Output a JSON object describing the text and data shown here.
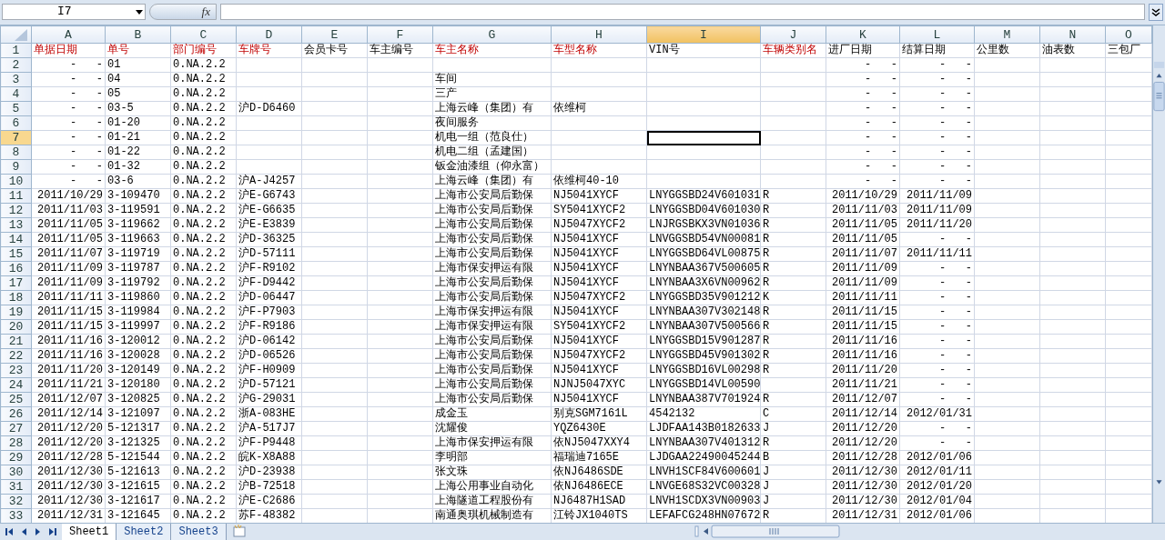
{
  "name_box": "I7",
  "function_label": "fx",
  "columns": [
    {
      "letter": "A",
      "selected": false
    },
    {
      "letter": "B",
      "selected": false
    },
    {
      "letter": "C",
      "selected": false
    },
    {
      "letter": "D",
      "selected": false
    },
    {
      "letter": "E",
      "selected": false
    },
    {
      "letter": "F",
      "selected": false
    },
    {
      "letter": "G",
      "selected": false
    },
    {
      "letter": "H",
      "selected": false
    },
    {
      "letter": "I",
      "selected": true
    },
    {
      "letter": "J",
      "selected": false
    },
    {
      "letter": "K",
      "selected": false
    },
    {
      "letter": "L",
      "selected": false
    },
    {
      "letter": "M",
      "selected": false
    },
    {
      "letter": "N",
      "selected": false
    },
    {
      "letter": "O",
      "selected": false
    }
  ],
  "field_row": {
    "number": "1",
    "selected": false,
    "cells": [
      {
        "text": "单据日期",
        "highlighted": true
      },
      {
        "text": "单号",
        "highlighted": true
      },
      {
        "text": "部门编号",
        "highlighted": true
      },
      {
        "text": "车牌号",
        "highlighted": true
      },
      {
        "text": "会员卡号",
        "highlighted": false
      },
      {
        "text": "车主编号",
        "highlighted": false
      },
      {
        "text": "车主名称",
        "highlighted": true
      },
      {
        "text": "车型名称",
        "highlighted": true
      },
      {
        "text": "VIN号",
        "highlighted": false
      },
      {
        "text": "车辆类别名",
        "highlighted": true
      },
      {
        "text": "进厂日期",
        "highlighted": false
      },
      {
        "text": "结算日期",
        "highlighted": false
      },
      {
        "text": "公里数",
        "highlighted": false
      },
      {
        "text": "油表数",
        "highlighted": false
      },
      {
        "text": "三包厂",
        "highlighted": false
      }
    ]
  },
  "rows": [
    {
      "number": "2",
      "selected": false,
      "cells": {
        "A": "-   -",
        "B": "01",
        "C": "0.NA.2.2",
        "K": "-   -",
        "L": "-   -"
      }
    },
    {
      "number": "3",
      "selected": false,
      "cells": {
        "A": "-   -",
        "B": "04",
        "C": "0.NA.2.2",
        "G": "车间",
        "K": "-   -",
        "L": "-   -"
      }
    },
    {
      "number": "4",
      "selected": false,
      "cells": {
        "A": "-   -",
        "B": "05",
        "C": "0.NA.2.2",
        "G": "三产",
        "K": "-   -",
        "L": "-   -"
      }
    },
    {
      "number": "5",
      "selected": false,
      "cells": {
        "A": "-   -",
        "B": "03-5",
        "C": "0.NA.2.2",
        "D": "沪D-D6460",
        "G": "上海云峰（集团）有",
        "H": "依维柯",
        "K": "-   -",
        "L": "-   -"
      }
    },
    {
      "number": "6",
      "selected": false,
      "cells": {
        "A": "-   -",
        "B": "01-20",
        "C": "0.NA.2.2",
        "G": "夜间服务",
        "K": "-   -",
        "L": "-   -"
      }
    },
    {
      "number": "7",
      "selected": true,
      "cells": {
        "A": "-   -",
        "B": "01-21",
        "C": "0.NA.2.2",
        "G": "机电一组（范良仕）",
        "K": "-   -",
        "L": "-   -"
      }
    },
    {
      "number": "8",
      "selected": false,
      "cells": {
        "A": "-   -",
        "B": "01-22",
        "C": "0.NA.2.2",
        "G": "机电二组（孟建国）",
        "K": "-   -",
        "L": "-   -"
      }
    },
    {
      "number": "9",
      "selected": false,
      "cells": {
        "A": "-   -",
        "B": "01-32",
        "C": "0.NA.2.2",
        "G": "钣金油漆组（仰永富）",
        "K": "-   -",
        "L": "-   -"
      }
    },
    {
      "number": "10",
      "selected": false,
      "cells": {
        "A": "-   -",
        "B": "03-6",
        "C": "0.NA.2.2",
        "D": "沪A-J4257",
        "G": "上海云峰（集团）有",
        "H": "依维柯40-10",
        "K": "-   -",
        "L": "-   -"
      }
    },
    {
      "number": "11",
      "selected": false,
      "cells": {
        "A": "2011/10/29",
        "B": "3-109470",
        "C": "0.NA.2.2",
        "D": "沪E-G6743",
        "G": "上海市公安局后勤保",
        "H": "NJ5041XYCF",
        "I": "LNYGGSBD24V601031",
        "J": "R",
        "K": "2011/10/29",
        "L": "2011/11/09"
      }
    },
    {
      "number": "12",
      "selected": false,
      "cells": {
        "A": "2011/11/03",
        "B": "3-119591",
        "C": "0.NA.2.2",
        "D": "沪E-G6635",
        "G": "上海市公安局后勤保",
        "H": "SY5041XYCF2",
        "I": "LNYGGSBD04V601030",
        "J": "R",
        "K": "2011/11/03",
        "L": "2011/11/09"
      }
    },
    {
      "number": "13",
      "selected": false,
      "cells": {
        "A": "2011/11/05",
        "B": "3-119662",
        "C": "0.NA.2.2",
        "D": "沪E-E3839",
        "G": "上海市公安局后勤保",
        "H": "NJ5047XYCF2",
        "I": "LNJRGSBKX3VN01036",
        "J": "R",
        "K": "2011/11/05",
        "L": "2011/11/20"
      }
    },
    {
      "number": "14",
      "selected": false,
      "cells": {
        "A": "2011/11/05",
        "B": "3-119663",
        "C": "0.NA.2.2",
        "D": "沪D-36325",
        "G": "上海市公安局后勤保",
        "H": "NJ5041XYCF",
        "I": "LNVGGSBD54VN00081",
        "J": "R",
        "K": "2011/11/05",
        "L": "-   -"
      }
    },
    {
      "number": "15",
      "selected": false,
      "cells": {
        "A": "2011/11/07",
        "B": "3-119719",
        "C": "0.NA.2.2",
        "D": "沪D-57111",
        "G": "上海市公安局后勤保",
        "H": "NJ5041XYCF",
        "I": "LNYGGSBD64VL00875",
        "J": "R",
        "K": "2011/11/07",
        "L": "2011/11/11"
      }
    },
    {
      "number": "16",
      "selected": false,
      "cells": {
        "A": "2011/11/09",
        "B": "3-119787",
        "C": "0.NA.2.2",
        "D": "沪F-R9102",
        "G": "上海市保安押运有限",
        "H": "NJ5041XYCF",
        "I": "LNYNBAA367V500605",
        "J": "R",
        "K": "2011/11/09",
        "L": "-   -"
      }
    },
    {
      "number": "17",
      "selected": false,
      "cells": {
        "A": "2011/11/09",
        "B": "3-119792",
        "C": "0.NA.2.2",
        "D": "沪F-D9442",
        "G": "上海市公安局后勤保",
        "H": "NJ5041XYCF",
        "I": "LNYNBAA3X6VN00962",
        "J": "R",
        "K": "2011/11/09",
        "L": "-   -"
      }
    },
    {
      "number": "18",
      "selected": false,
      "cells": {
        "A": "2011/11/11",
        "B": "3-119860",
        "C": "0.NA.2.2",
        "D": "沪D-06447",
        "G": "上海市公安局后勤保",
        "H": "NJ5047XYCF2",
        "I": "LNYGGSBD35V901212",
        "J": "K",
        "K": "2011/11/11",
        "L": "-   -"
      }
    },
    {
      "number": "19",
      "selected": false,
      "cells": {
        "A": "2011/11/15",
        "B": "3-119984",
        "C": "0.NA.2.2",
        "D": "沪F-P7903",
        "G": "上海市保安押运有限",
        "H": "NJ5041XYCF",
        "I": "LNYNBAA307V302148",
        "J": "R",
        "K": "2011/11/15",
        "L": "-   -"
      }
    },
    {
      "number": "20",
      "selected": false,
      "cells": {
        "A": "2011/11/15",
        "B": "3-119997",
        "C": "0.NA.2.2",
        "D": "沪F-R9186",
        "G": "上海市保安押运有限",
        "H": "SY5041XYCF2",
        "I": "LNYNBAA307V500566",
        "J": "R",
        "K": "2011/11/15",
        "L": "-   -"
      }
    },
    {
      "number": "21",
      "selected": false,
      "cells": {
        "A": "2011/11/16",
        "B": "3-120012",
        "C": "0.NA.2.2",
        "D": "沪D-06142",
        "G": "上海市公安局后勤保",
        "H": "NJ5041XYCF",
        "I": "LNYGGSBD15V901287",
        "J": "R",
        "K": "2011/11/16",
        "L": "-   -"
      }
    },
    {
      "number": "22",
      "selected": false,
      "cells": {
        "A": "2011/11/16",
        "B": "3-120028",
        "C": "0.NA.2.2",
        "D": "沪D-06526",
        "G": "上海市公安局后勤保",
        "H": "NJ5047XYCF2",
        "I": "LNYGGSBD45V901302",
        "J": "R",
        "K": "2011/11/16",
        "L": "-   -"
      }
    },
    {
      "number": "23",
      "selected": false,
      "cells": {
        "A": "2011/11/20",
        "B": "3-120149",
        "C": "0.NA.2.2",
        "D": "沪F-H0909",
        "G": "上海市公安局后勤保",
        "H": "NJ5041XYCF",
        "I": "LNYGGSBD16VL00298",
        "J": "R",
        "K": "2011/11/20",
        "L": "-   -"
      }
    },
    {
      "number": "24",
      "selected": false,
      "cells": {
        "A": "2011/11/21",
        "B": "3-120180",
        "C": "0.NA.2.2",
        "D": "沪D-57121",
        "G": "上海市公安局后勤保",
        "H": "NJNJ5047XYC",
        "I": "LNYGGSBD14VL00590",
        "K": "2011/11/21",
        "L": "-   -"
      }
    },
    {
      "number": "25",
      "selected": false,
      "cells": {
        "A": "2011/12/07",
        "B": "3-120825",
        "C": "0.NA.2.2",
        "D": "沪G-29031",
        "G": "上海市公安局后勤保",
        "H": "NJ5041XYCF",
        "I": "LNYNBAA387V701924",
        "J": "R",
        "K": "2011/12/07",
        "L": "-   -"
      }
    },
    {
      "number": "26",
      "selected": false,
      "cells": {
        "A": "2011/12/14",
        "B": "3-121097",
        "C": "0.NA.2.2",
        "D": "浙A-083HE",
        "G": "成金玉",
        "H": "别克SGM7161L",
        "I": "4542132",
        "J": "C",
        "K": "2011/12/14",
        "L": "2012/01/31"
      }
    },
    {
      "number": "27",
      "selected": false,
      "cells": {
        "A": "2011/12/20",
        "B": "5-121317",
        "C": "0.NA.2.2",
        "D": "沪A-517J7",
        "G": "沈耀俊",
        "H": "YQZ6430E",
        "I": "LJDFAA143B0182633",
        "J": "J",
        "K": "2011/12/20",
        "L": "-   -"
      }
    },
    {
      "number": "28",
      "selected": false,
      "cells": {
        "A": "2011/12/20",
        "B": "3-121325",
        "C": "0.NA.2.2",
        "D": "沪F-P9448",
        "G": "上海市保安押运有限",
        "H": "依NJ5047XXY4",
        "I": "LNYNBAA307V401312",
        "J": "R",
        "K": "2011/12/20",
        "L": "-   -"
      }
    },
    {
      "number": "29",
      "selected": false,
      "cells": {
        "A": "2011/12/28",
        "B": "5-121544",
        "C": "0.NA.2.2",
        "D": "皖K-X8A88",
        "G": "李明部",
        "H": "福瑞迪7165E",
        "I": "LJDGAA22490045244",
        "J": "B",
        "K": "2011/12/28",
        "L": "2012/01/06"
      }
    },
    {
      "number": "30",
      "selected": false,
      "cells": {
        "A": "2011/12/30",
        "B": "5-121613",
        "C": "0.NA.2.2",
        "D": "沪D-23938",
        "G": "张文珠",
        "H": "依NJ6486SDE",
        "I": "LNVH1SCF84V600601",
        "J": "J",
        "K": "2011/12/30",
        "L": "2012/01/11"
      }
    },
    {
      "number": "31",
      "selected": false,
      "cells": {
        "A": "2011/12/30",
        "B": "3-121615",
        "C": "0.NA.2.2",
        "D": "沪B-72518",
        "G": "上海公用事业自动化",
        "H": "依NJ6486ECE",
        "I": "LNVGE68S32VC00328",
        "J": "J",
        "K": "2011/12/30",
        "L": "2012/01/20"
      }
    },
    {
      "number": "32",
      "selected": false,
      "cells": {
        "A": "2011/12/30",
        "B": "3-121617",
        "C": "0.NA.2.2",
        "D": "沪E-C2686",
        "G": "上海隧道工程股份有",
        "H": "NJ6487H1SAD",
        "I": "LNVH1SCDX3VN00903",
        "J": "J",
        "K": "2011/12/30",
        "L": "2012/01/04"
      }
    },
    {
      "number": "33",
      "selected": false,
      "cells": {
        "A": "2011/12/31",
        "B": "3-121645",
        "C": "0.NA.2.2",
        "D": "苏F-48382",
        "G": "南通奥琪机械制造有",
        "H": "江铃JX1040TS",
        "I": "LEFAFCG248HN07672",
        "J": "R",
        "K": "2011/12/31",
        "L": "2012/01/06"
      }
    }
  ],
  "sheet_tabs": [
    {
      "label": "Sheet1",
      "selected": true
    },
    {
      "label": "Sheet2",
      "selected": false
    },
    {
      "label": "Sheet3",
      "selected": false
    }
  ]
}
